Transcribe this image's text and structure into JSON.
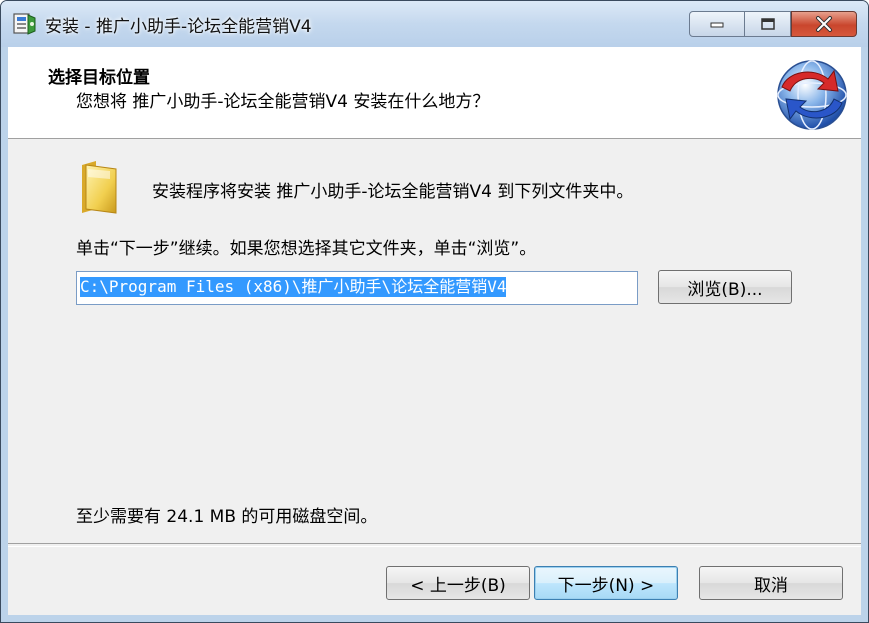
{
  "window": {
    "title": "安装 - 推广小助手-论坛全能营销V4"
  },
  "header": {
    "title": "选择目标位置",
    "subtitle": "您想将 推广小助手-论坛全能营销V4 安装在什么地方？"
  },
  "body": {
    "info": "安装程序将安装 推广小助手-论坛全能营销V4 到下列文件夹中。",
    "instruction": "单击“下一步”继续。如果您想选择其它文件夹，单击“浏览”。",
    "install_path": "C:\\Program Files (x86)\\推广小助手\\论坛全能营销V4",
    "browse_label": "浏览(B)...",
    "disk_space": "至少需要有 24.1 MB 的可用磁盘空间。"
  },
  "footer": {
    "back_label": "< 上一步(B)",
    "next_label": "下一步(N) >",
    "cancel_label": "取消"
  },
  "icons": {
    "app": "installer-app-icon",
    "folder": "folder-icon",
    "logo": "setup-logo-icon",
    "minimize": "minimize-icon",
    "maximize": "maximize-icon",
    "close": "close-icon"
  }
}
